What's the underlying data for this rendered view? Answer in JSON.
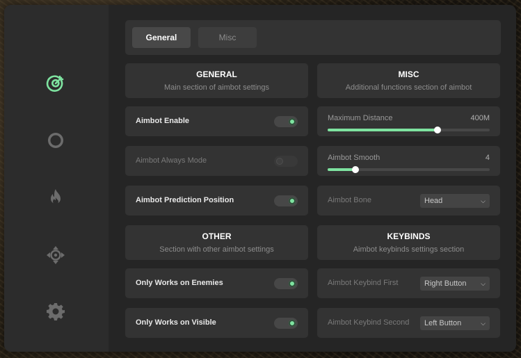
{
  "tabs": {
    "general": "General",
    "misc": "Misc"
  },
  "sidebar": {
    "icons": [
      "target-icon",
      "radar-icon",
      "fire-icon",
      "crosshair-move-icon",
      "gear-icon"
    ],
    "active_color": "#7ee3a0"
  },
  "general_section": {
    "title": "GENERAL",
    "subtitle": "Main section of aimbot settings"
  },
  "misc_section": {
    "title": "MISC",
    "subtitle": "Additional functions section of aimbot"
  },
  "other_section": {
    "title": "OTHER",
    "subtitle": "Section with other aimbot settings"
  },
  "keybinds_section": {
    "title": "KEYBINDS",
    "subtitle": "Aimbot keybinds settings section"
  },
  "toggles": {
    "aimbot_enable": {
      "label": "Aimbot Enable",
      "on": true
    },
    "always_mode": {
      "label": "Aimbot Always Mode",
      "on": false
    },
    "prediction": {
      "label": "Aimbot Prediction Position",
      "on": true
    },
    "enemies": {
      "label": "Only Works on Enemies",
      "on": true
    },
    "visible": {
      "label": "Only Works on Visible",
      "on": true
    }
  },
  "sliders": {
    "max_distance": {
      "label": "Maximum Distance",
      "value": "400M",
      "fraction": 0.68
    },
    "smooth": {
      "label": "Aimbot Smooth",
      "value": "4",
      "fraction": 0.17
    }
  },
  "selects": {
    "bone": {
      "label": "Aimbot Bone",
      "value": "Head"
    },
    "keybind_first": {
      "label": "Aimbot Keybind First",
      "value": "Right Button"
    },
    "keybind_second": {
      "label": "Aimbot Keybind Second",
      "value": "Left Button"
    }
  },
  "accent_color": "#7ee3a0"
}
